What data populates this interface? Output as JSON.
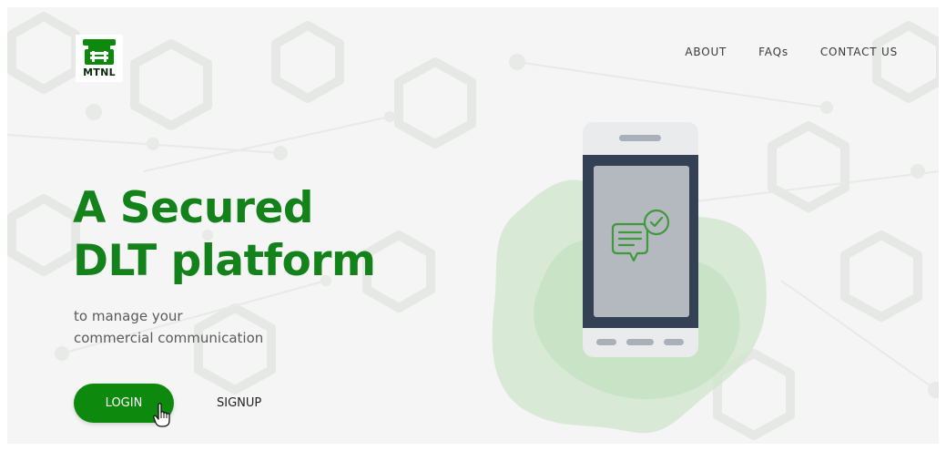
{
  "brand": {
    "name": "MTNL"
  },
  "nav": {
    "items": [
      "ABOUT",
      "FAQs",
      "CONTACT US"
    ]
  },
  "hero": {
    "title_line1": "A Secured",
    "title_line2": "DLT platform",
    "subtitle_line1": "to manage your",
    "subtitle_line2": "commercial communication"
  },
  "actions": {
    "login_label": "LOGIN",
    "signup_label": "SIGNUP"
  },
  "colors": {
    "brand_green": "#14821a",
    "button_green": "#0d8a0d",
    "phone_frame": "#e9ebed",
    "phone_screen_border": "#344154",
    "phone_screen": "#b4b8bf"
  },
  "icons": {
    "logo": "mtnl-telephone-logo",
    "phone": "smartphone-illustration",
    "message": "chat-message-check-icon",
    "cursor": "hand-pointer-cursor"
  }
}
